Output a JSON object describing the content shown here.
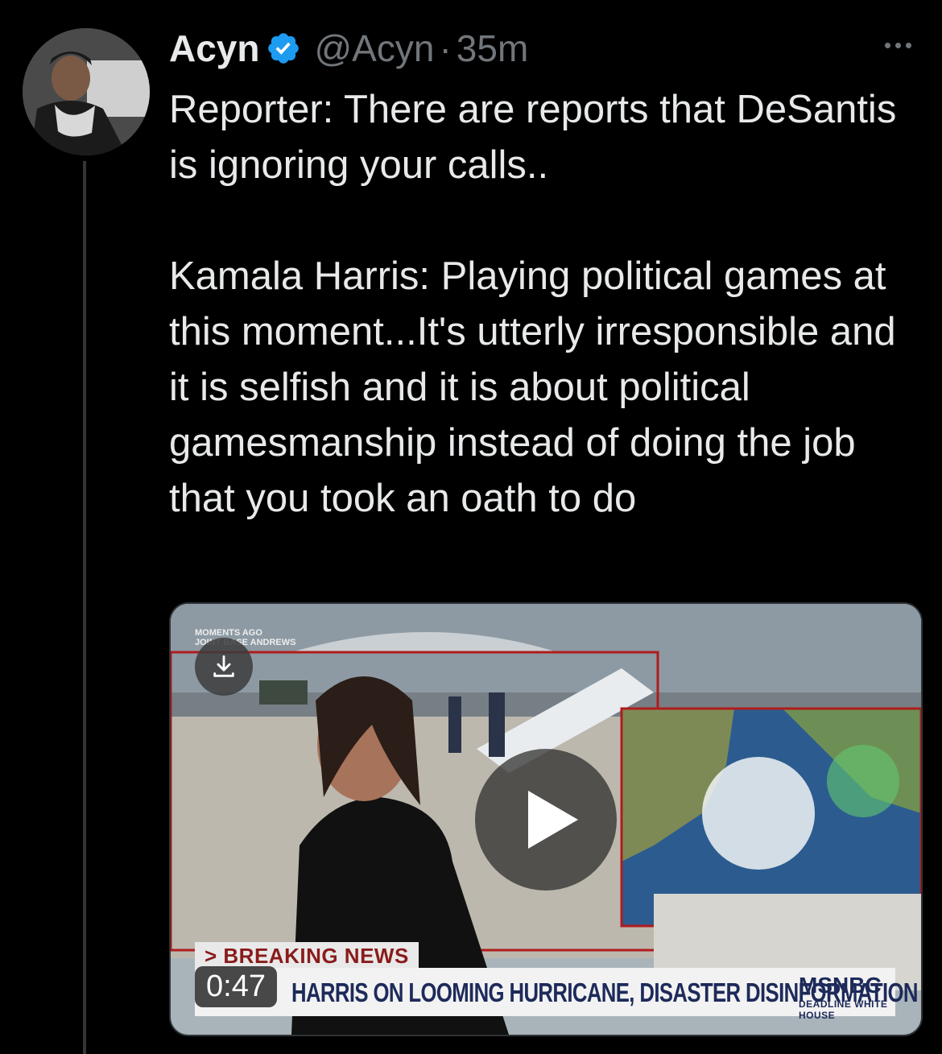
{
  "tweet": {
    "author_name": "Acyn",
    "handle": "@Acyn",
    "separator": "·",
    "time": "35m",
    "paragraphs": [
      "Reporter: There are reports that DeSantis is ignoring your calls..",
      "Kamala Harris: Playing political games at this moment...It's utterly irresponsible and it is selfish and it is about political gamesmanship instead of doing the job that you took an oath to do"
    ],
    "icons": {
      "verified": "verified-badge-icon",
      "more": "more-options-icon"
    }
  },
  "video": {
    "duration": "0:47",
    "overlay_top": "MOMENTS AGO",
    "overlay_location": "JOINT BASE ANDREWS",
    "breaking_label": "> BREAKING NEWS",
    "headline": "HARRIS ON LOOMING HURRICANE, DISASTER DISINFORMATION",
    "network": "MSNBC",
    "show": "DEADLINE WHITE HOUSE",
    "icons": {
      "download": "download-icon",
      "play": "play-icon"
    }
  },
  "colors": {
    "background": "#000000",
    "text": "#e7e9ea",
    "secondary_text": "#71767b",
    "verified_blue": "#1d9bf0"
  }
}
